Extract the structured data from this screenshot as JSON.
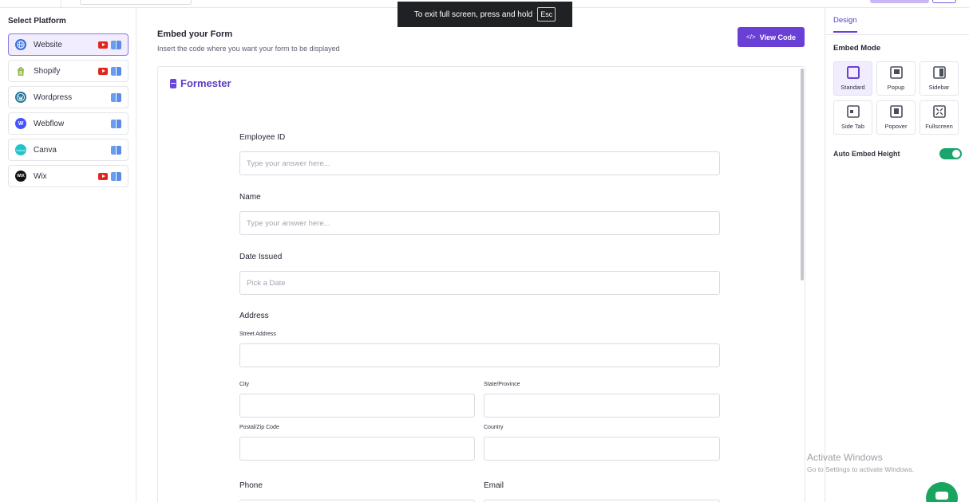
{
  "fullscreen_toast": {
    "text": "To exit full screen, press and hold",
    "key": "Esc"
  },
  "left_panel": {
    "title": "Select Platform",
    "platforms": [
      {
        "name": "Website",
        "logo": "globe-icon",
        "color": "#3b6fd8",
        "video": true,
        "active": true
      },
      {
        "name": "Shopify",
        "logo": "shopify-bag-icon",
        "color": "#95bf47",
        "video": true,
        "active": false
      },
      {
        "name": "Wordpress",
        "logo": "wordpress-icon",
        "color": "#21759b",
        "video": false,
        "active": false
      },
      {
        "name": "Webflow",
        "logo": "webflow-icon",
        "color": "#4353ff",
        "video": false,
        "active": false
      },
      {
        "name": "Canva",
        "logo": "canva-icon",
        "color": "#20c4cb",
        "video": false,
        "active": false
      },
      {
        "name": "Wix",
        "logo": "wix-icon",
        "color": "#111111",
        "video": true,
        "active": false
      }
    ],
    "logo_text": {
      "webflow": "W",
      "canva": "Canva",
      "wix": "WIX"
    }
  },
  "main": {
    "title": "Embed your Form",
    "subtitle": "Insert the code where you want your form to be displayed",
    "view_code_label": "View Code",
    "view_code_glyph": "</>"
  },
  "form": {
    "brand": "Formester",
    "fields": {
      "employee_id": {
        "label": "Employee ID",
        "placeholder": "Type your answer here..."
      },
      "name": {
        "label": "Name",
        "placeholder": "Type your answer here..."
      },
      "date_issued": {
        "label": "Date Issued",
        "placeholder": "Pick a Date"
      },
      "address": {
        "label": "Address",
        "street": "Street Address",
        "city": "City",
        "state": "State/Province",
        "postal": "Postal/Zip Code",
        "country": "Country"
      },
      "phone": {
        "label": "Phone"
      },
      "email": {
        "label": "Email"
      }
    }
  },
  "right_panel": {
    "tab": "Design",
    "embed_mode_title": "Embed Mode",
    "modes": [
      {
        "name": "Standard",
        "icon": "standard-mode-icon",
        "active": true
      },
      {
        "name": "Popup",
        "icon": "popup-mode-icon",
        "active": false
      },
      {
        "name": "Sidebar",
        "icon": "sidebar-mode-icon",
        "active": false
      },
      {
        "name": "Side Tab",
        "icon": "side-tab-mode-icon",
        "active": false
      },
      {
        "name": "Popover",
        "icon": "popover-mode-icon",
        "active": false
      },
      {
        "name": "Fullscreen",
        "icon": "fullscreen-mode-icon",
        "active": false
      }
    ],
    "auto_embed_height_label": "Auto Embed Height",
    "auto_embed_height_on": true,
    "accent_color": "#6a3fd6",
    "toggle_color": "#19a56b"
  },
  "os_watermark": {
    "line1": "Activate Windows",
    "line2": "Go to Settings to activate Windows."
  }
}
